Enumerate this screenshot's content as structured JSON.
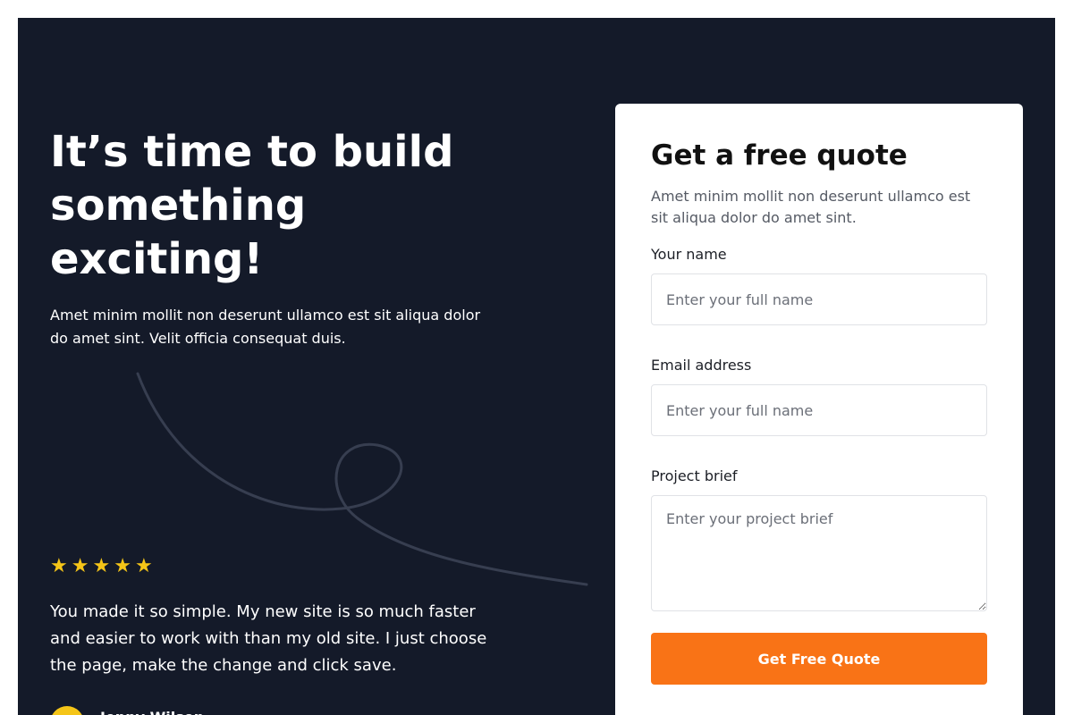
{
  "hero": {
    "headline": "It’s time to build something exciting!",
    "subtext": "Amet minim mollit non deserunt ullamco est sit aliqua dolor do amet sint. Velit officia consequat duis."
  },
  "testimonial": {
    "rating": 5,
    "stars": "★★★★★",
    "quote": "You made it so simple. My new site is so much faster and easier to work with than my old site. I just choose the page, make the change and click save.",
    "author_name": "Jenny Wilson"
  },
  "form": {
    "title": "Get a free quote",
    "description": "Amet minim mollit non deserunt ullamco est sit aliqua dolor do amet sint.",
    "name_label": "Your name",
    "name_placeholder": "Enter your full name",
    "email_label": "Email address",
    "email_placeholder": "Enter your full name",
    "brief_label": "Project brief",
    "brief_placeholder": "Enter your project brief",
    "submit_label": "Get Free Quote"
  },
  "colors": {
    "panel_background": "#141a29",
    "accent": "#f97316",
    "star": "#f5c518"
  },
  "icons": {
    "star": "star-icon",
    "decoration": "squiggle-line"
  }
}
